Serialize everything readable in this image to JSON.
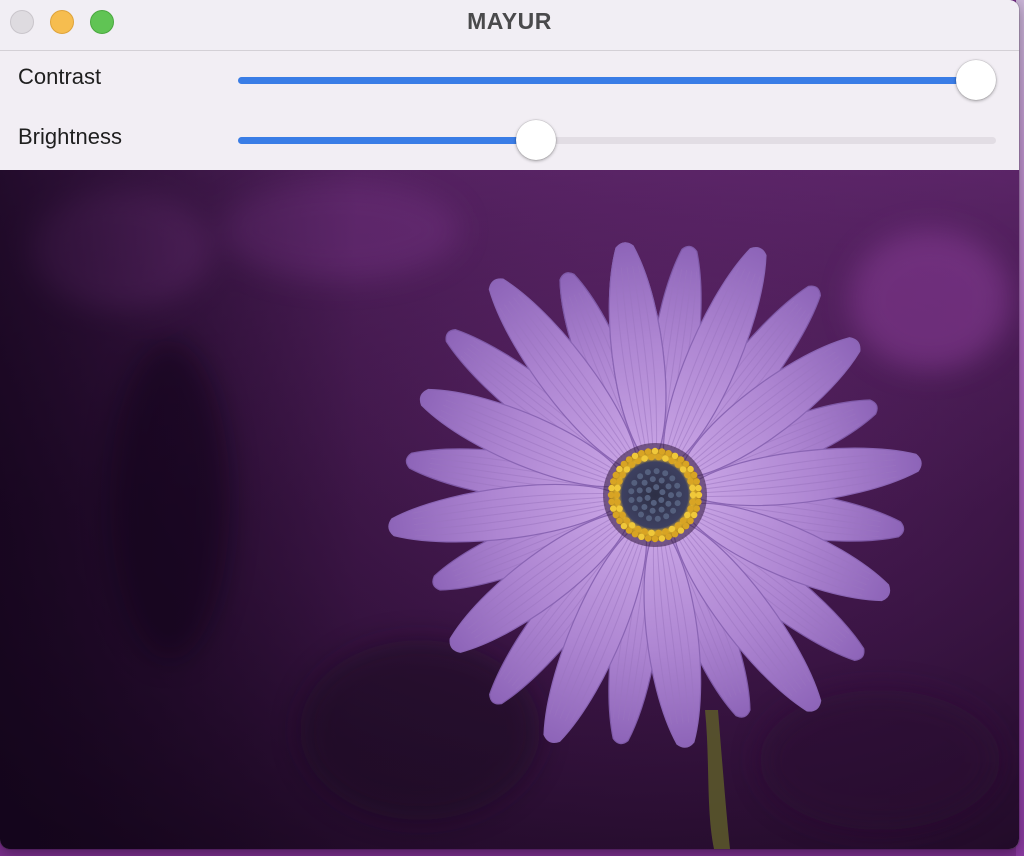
{
  "window": {
    "title": "MAYUR"
  },
  "controls": {
    "contrast": {
      "label": "Contrast",
      "value": 1.0
    },
    "brightness": {
      "label": "Brightness",
      "value": 0.387
    }
  },
  "image": {
    "subject": "purple daisy flower on dark purple background"
  },
  "colors": {
    "accent": "#3a7de6",
    "track": "#e2dde4",
    "background_dark": "#3a1540",
    "petal": "#b890d8",
    "flower_center": "#e0b42a"
  }
}
